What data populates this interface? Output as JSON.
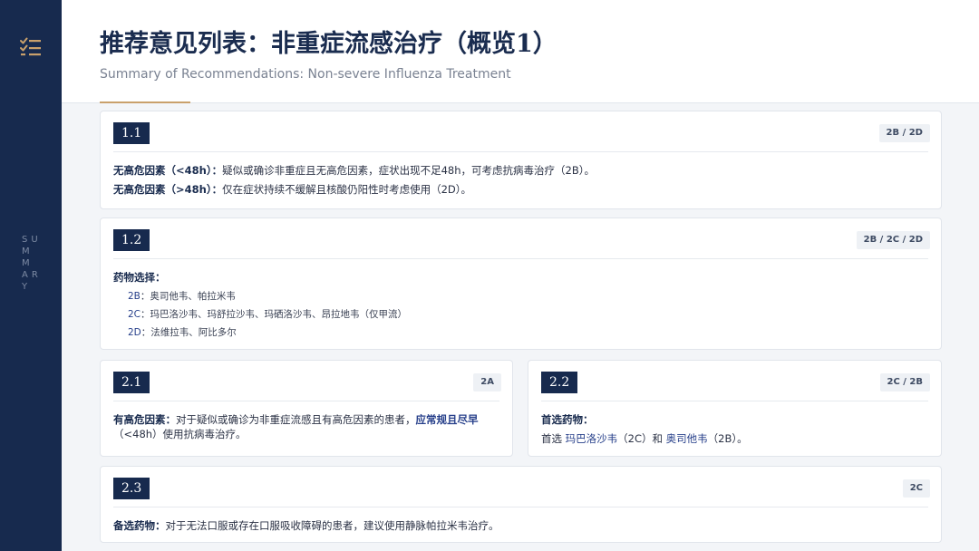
{
  "header": {
    "title": "推荐意见列表：非重症流感治疗（概览1）",
    "subtitle": "Summary of Recommendations: Non-severe Influenza Treatment"
  },
  "sidebar": {
    "icon": "checklist-icon",
    "vertical_text": "SUMMARY"
  },
  "colors": {
    "navy": "#172a4e",
    "accent": "#c9a06b",
    "highlight_blue": "#263f8a"
  },
  "cards": {
    "c11": {
      "number": "1.1",
      "grade": "2B / 2D",
      "lines": [
        {
          "label": "无高危因素（<48h）：",
          "text": "疑似或确诊非重症且无高危因素，症状出现不足48h，可考虑抗病毒治疗（2B）。"
        },
        {
          "label": "无高危因素（>48h）：",
          "text": "仅在症状持续不缓解且核酸仍阳性时考虑使用（2D）。"
        }
      ]
    },
    "c12": {
      "number": "1.2",
      "grade": "2B / 2C / 2D",
      "heading": "药物选择：",
      "items": [
        {
          "code": "2B",
          "text": "：奥司他韦、帕拉米韦"
        },
        {
          "code": "2C",
          "text": "：玛巴洛沙韦、玛舒拉沙韦、玛硒洛沙韦、昂拉地韦（仅甲流）"
        },
        {
          "code": "2D",
          "text": "：法维拉韦、阿比多尔"
        }
      ]
    },
    "c21": {
      "number": "2.1",
      "grade": "2A",
      "label": "有高危因素：",
      "text": "对于疑似或确诊为非重症流感且有高危因素的患者，",
      "emphasis": "应常规且尽早",
      "text2": "（<48h）使用抗病毒治疗。"
    },
    "c22": {
      "number": "2.2",
      "grade": "2C / 2B",
      "heading": "首选药物：",
      "pre": "首选 ",
      "drug1": "玛巴洛沙韦",
      "mid": "（2C）和 ",
      "drug2": "奥司他韦",
      "post": "（2B）。"
    },
    "c23": {
      "number": "2.3",
      "grade": "2C",
      "label": "备选药物：",
      "text": "对于无法口服或存在口服吸收障碍的患者，建议使用静脉帕拉米韦治疗。"
    }
  }
}
